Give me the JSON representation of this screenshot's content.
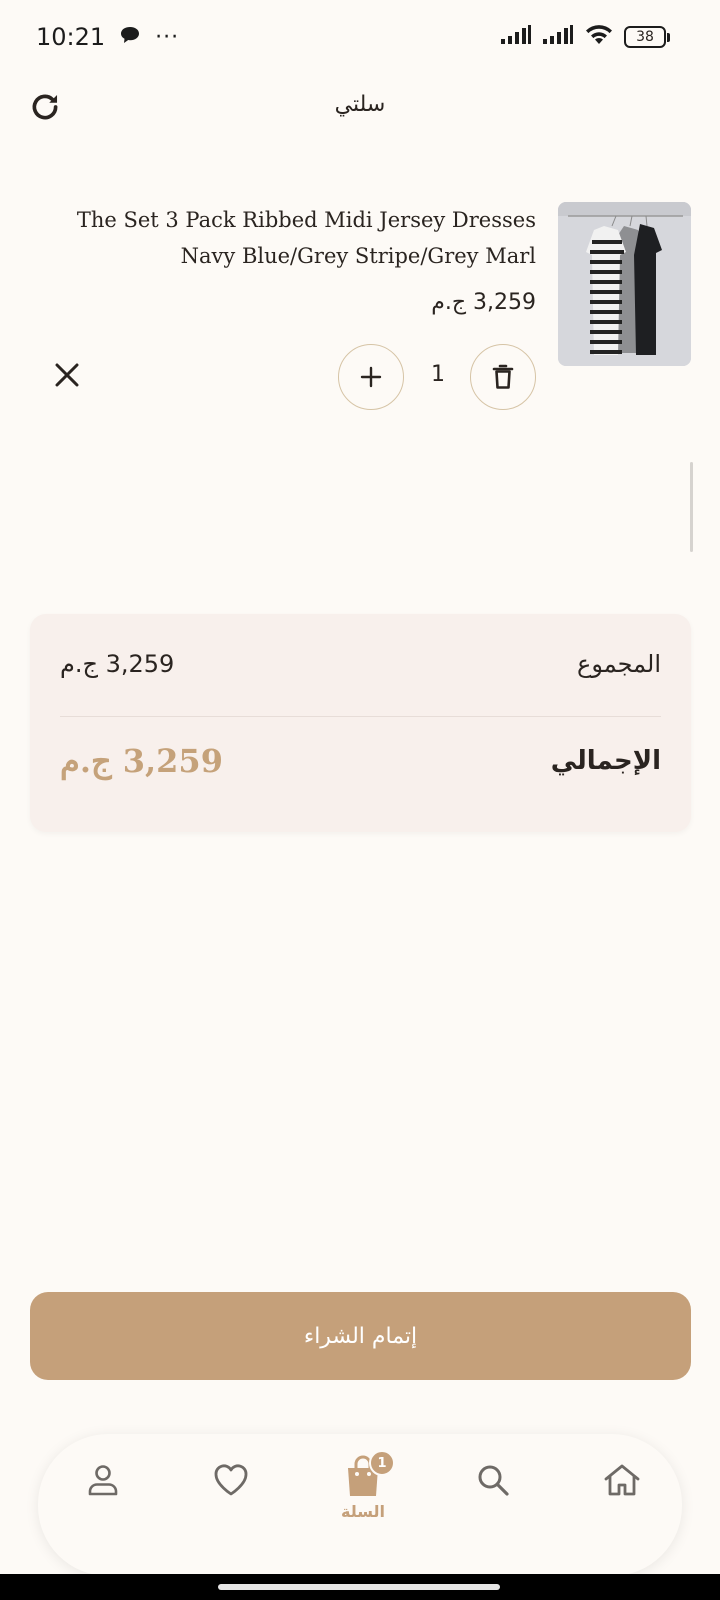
{
  "status_bar": {
    "time": "10:21",
    "more_dots": "···",
    "battery": "38",
    "icons": [
      "chat-bubble-icon",
      "signal-icon",
      "signal-icon",
      "wifi-icon",
      "battery-icon"
    ]
  },
  "header": {
    "title": "سلتي",
    "refresh_icon": "refresh-icon"
  },
  "cart": {
    "items": [
      {
        "name": "The Set 3 Pack Ribbed Midi Jersey Dresses Navy Blue/Grey Stripe/Grey Marl",
        "price": "3,259 ج.م",
        "quantity": "1",
        "image": "dresses-product-image"
      }
    ]
  },
  "summary": {
    "subtotal_label": "المجموع",
    "subtotal_value": "3,259 ج.م",
    "total_label": "الإجمالي",
    "total_value": "3,259 ج.م"
  },
  "checkout": {
    "label": "إتمام الشراء"
  },
  "nav": {
    "items": [
      {
        "icon": "profile-icon"
      },
      {
        "icon": "heart-icon"
      },
      {
        "icon": "shopping-bag-icon",
        "label": "السلة",
        "badge": "1",
        "active": true
      },
      {
        "icon": "search-icon"
      },
      {
        "icon": "home-icon"
      }
    ]
  },
  "colors": {
    "accent": "#c5a07a",
    "background": "#fdfaf6",
    "summary_bg": "#f8f0ec",
    "text": "#2a2420"
  }
}
